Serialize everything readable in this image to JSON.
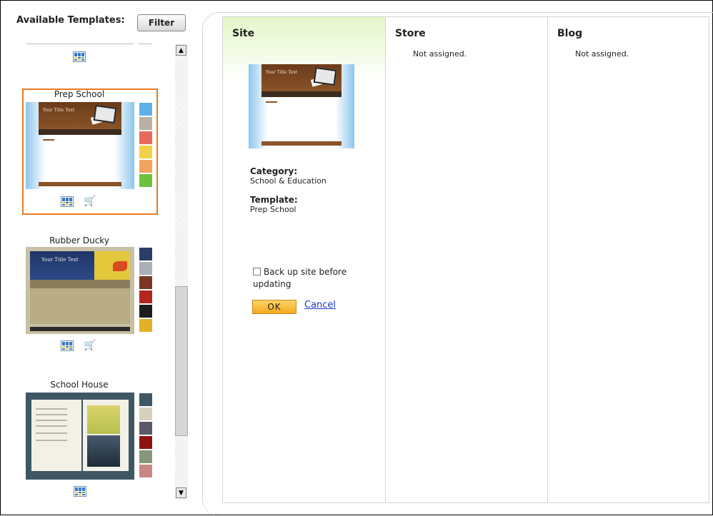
{
  "left_panel": {
    "title": "Available Templates:",
    "filter_label": "Filter",
    "templates": [
      {
        "name": "Prep School",
        "selected": true,
        "thumb_title": "Your Title Text",
        "swatches": [
          "#5fb0e4",
          "#b8b1a4",
          "#e86a5c",
          "#f3d04a",
          "#f2a35c",
          "#6cc33a"
        ]
      },
      {
        "name": "Rubber Ducky",
        "selected": false,
        "thumb_title": "Your Title Text",
        "swatches": [
          "#2a3e66",
          "#a9b0b7",
          "#7c3526",
          "#b5241f",
          "#1d1d1d",
          "#e3b125"
        ]
      },
      {
        "name": "School House",
        "selected": false,
        "swatches": [
          "#3f5863",
          "#d6d0bd",
          "#5b5a68",
          "#8d1313",
          "#86967a",
          "#c98782"
        ]
      }
    ]
  },
  "columns": {
    "site": {
      "heading": "Site",
      "thumb_title": "Your Title Text",
      "category_label": "Category:",
      "category_value": "School & Education",
      "template_label": "Template:",
      "template_value": "Prep School",
      "backup_label": "Back up site before updating",
      "backup_checked": false,
      "ok_label": "OK",
      "cancel_label": "Cancel"
    },
    "store": {
      "heading": "Store",
      "status": "Not assigned."
    },
    "blog": {
      "heading": "Blog",
      "status": "Not assigned."
    }
  }
}
